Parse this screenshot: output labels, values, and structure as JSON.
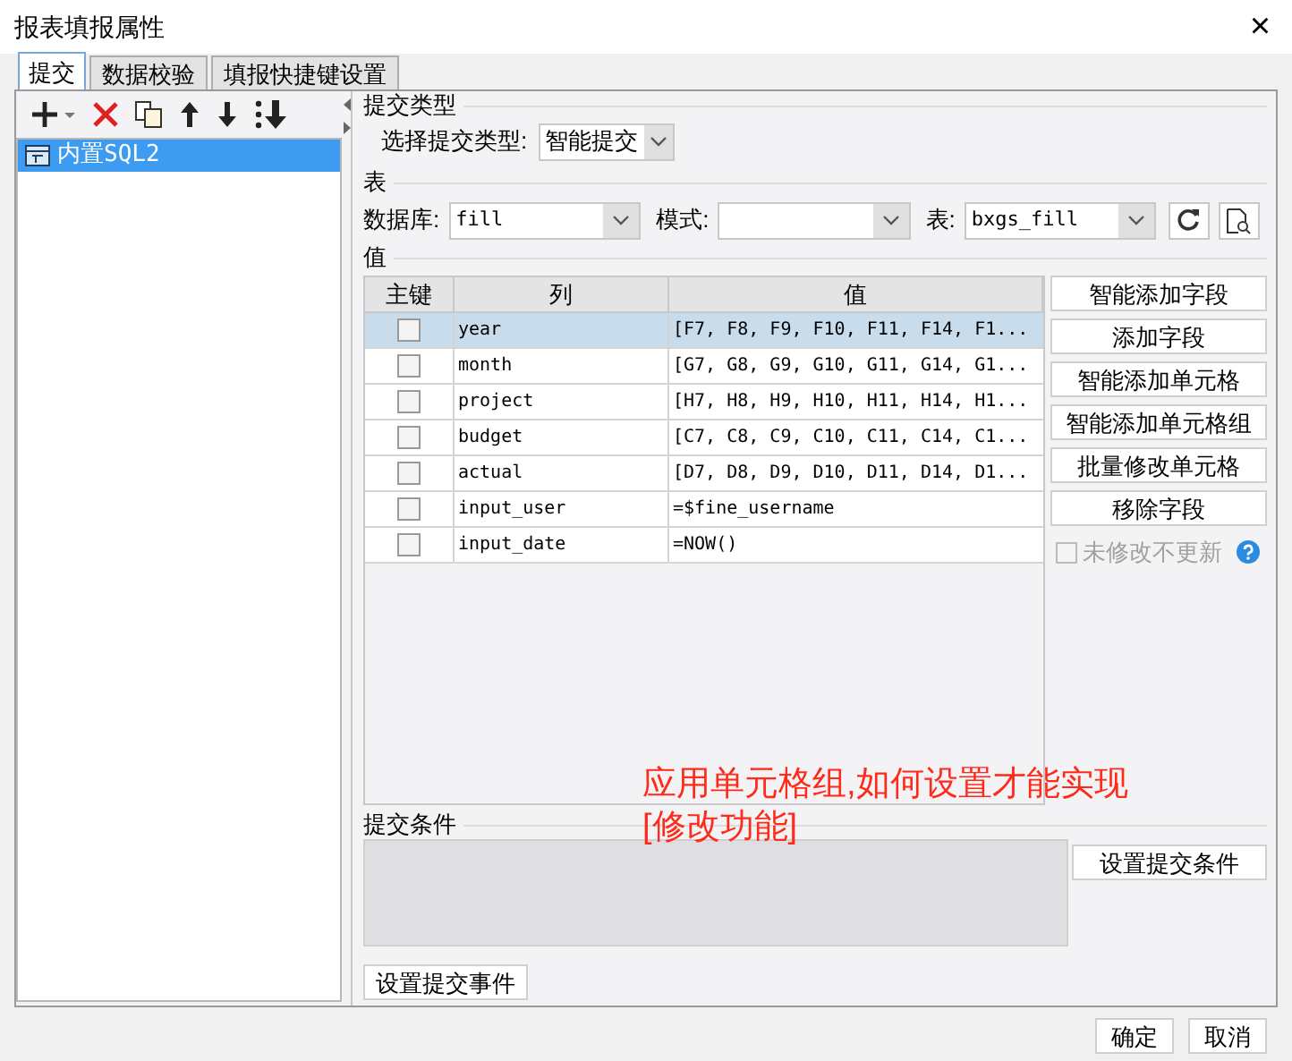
{
  "window": {
    "title": "报表填报属性",
    "close": "×"
  },
  "tabs": [
    {
      "label": "提交",
      "selected": true
    },
    {
      "label": "数据校验",
      "selected": false
    },
    {
      "label": "填报快捷键设置",
      "selected": false
    }
  ],
  "submit_list": {
    "items": [
      {
        "label": "内置SQL2",
        "selected": true
      }
    ]
  },
  "submit_type": {
    "legend": "提交类型",
    "label": "选择提交类型:",
    "value": "智能提交"
  },
  "table_section": {
    "legend": "表",
    "database_label": "数据库:",
    "database": "fill",
    "schema_label": "模式:",
    "table_label": "表:",
    "table": "bxgs_fill"
  },
  "values_section": {
    "legend": "值",
    "columns": [
      "主键",
      "列",
      "值"
    ],
    "rows": [
      {
        "column": "year",
        "value": "[F7, F8, F9, F10, F11, F14, F1...",
        "selected": true,
        "primary_key": false
      },
      {
        "column": "month",
        "value": "[G7, G8, G9, G10, G11, G14, G1...",
        "selected": false,
        "primary_key": false
      },
      {
        "column": "project",
        "value": "[H7, H8, H9, H10, H11, H14, H1...",
        "selected": false,
        "primary_key": false
      },
      {
        "column": "budget",
        "value": "[C7, C8, C9, C10, C11, C14, C1...",
        "selected": false,
        "primary_key": false
      },
      {
        "column": "actual",
        "value": "[D7, D8, D9, D10, D11, D14, D1...",
        "selected": false,
        "primary_key": false
      },
      {
        "column": "input_user",
        "value": "=$fine_username",
        "selected": false,
        "primary_key": false
      },
      {
        "column": "input_date",
        "value": "=NOW()",
        "selected": false,
        "primary_key": false
      }
    ],
    "buttons": [
      "智能添加字段",
      "添加字段",
      "智能添加单元格",
      "智能添加单元格组",
      "批量修改单元格",
      "移除字段"
    ],
    "no_update_checkbox": {
      "label": "未修改不更新",
      "checked": false,
      "disabled": true
    }
  },
  "condition_section": {
    "legend": "提交条件",
    "button": "设置提交条件"
  },
  "event_button": "设置提交事件",
  "annotation": [
    "应用单元格组,如何设置才能实现",
    "[修改功能]"
  ],
  "footer_buttons": [
    "确定",
    "取消"
  ]
}
